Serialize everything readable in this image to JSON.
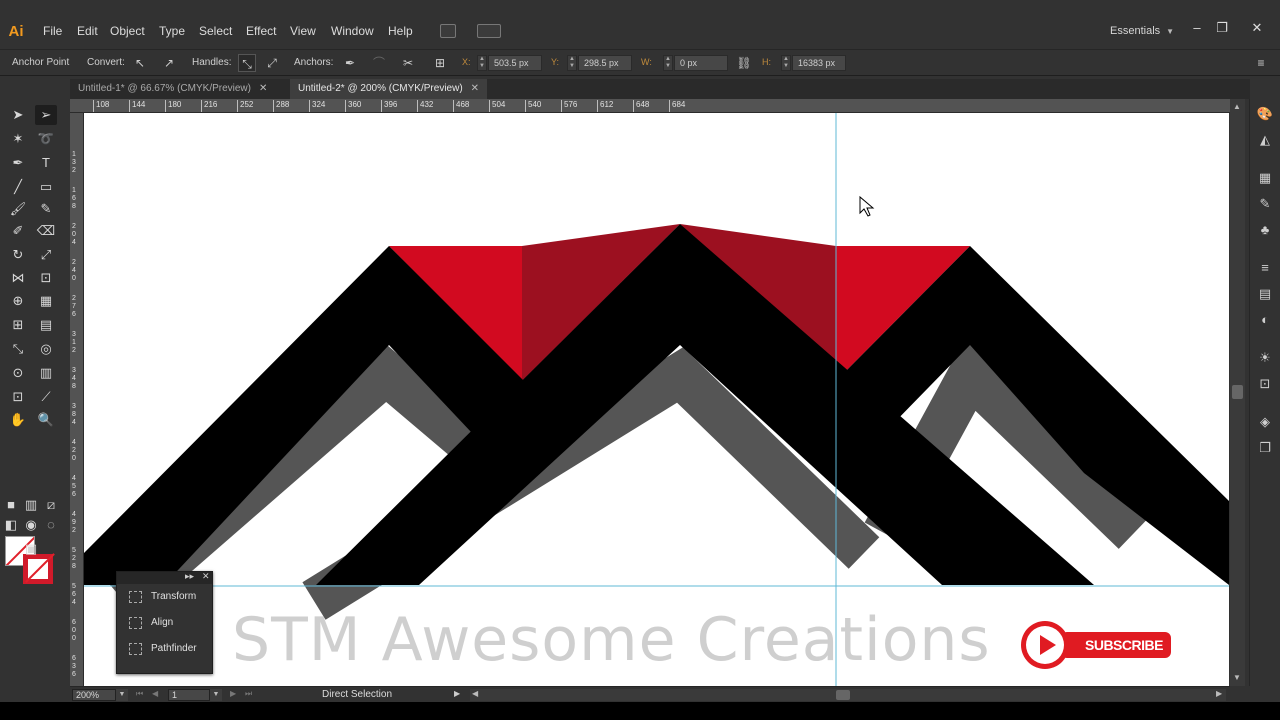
{
  "app": {
    "logo": "Ai",
    "menus": [
      "File",
      "Edit",
      "Object",
      "Type",
      "Select",
      "Effect",
      "View",
      "Window",
      "Help"
    ],
    "workspace": "Essentials"
  },
  "window_controls": {
    "minimize": "–",
    "restore": "❐",
    "close": "✕"
  },
  "control_bar": {
    "mode_label": "Anchor Point",
    "convert_label": "Convert:",
    "handles_label": "Handles:",
    "anchors_label": "Anchors:",
    "x_label": "X:",
    "x_value": "503.5 px",
    "y_label": "Y:",
    "y_value": "298.5 px",
    "w_label": "W:",
    "w_value": "0 px",
    "h_label": "H:",
    "h_value": "16383 px"
  },
  "tabs": [
    {
      "label": "Untitled-1* @ 66.67% (CMYK/Preview)",
      "active": false
    },
    {
      "label": "Untitled-2* @ 200% (CMYK/Preview)",
      "active": true
    }
  ],
  "ruler_h": [
    "108",
    "144",
    "180",
    "216",
    "252",
    "288",
    "324",
    "360",
    "396",
    "432",
    "468",
    "504",
    "540",
    "576",
    "612",
    "648",
    "684"
  ],
  "ruler_v": [
    "1\n3\n2",
    "1\n6\n8",
    "2\n0\n4",
    "2\n4\n0",
    "2\n7\n6",
    "3\n1\n2",
    "3\n4\n8",
    "3\n8\n4",
    "4\n2\n0",
    "4\n5\n6",
    "4\n9\n2",
    "5\n2\n8",
    "5\n6\n4",
    "6\n0\n0",
    "6\n3\n6",
    "6\n7\n2"
  ],
  "canvas": {
    "watermark": "STM Awesome Creations",
    "subscribe": "SUBSCRIBE",
    "colors": {
      "red": "#d20a20",
      "dark_red": "#9c1020",
      "black": "#000000",
      "shadow": "#555555",
      "guide": "#5fb8d6"
    }
  },
  "float_panel": {
    "items": [
      "Transform",
      "Align",
      "Pathfinder"
    ],
    "collapse": "▸▸",
    "close": "✕"
  },
  "status": {
    "zoom": "200%",
    "page": "1",
    "tool": "Direct Selection"
  }
}
